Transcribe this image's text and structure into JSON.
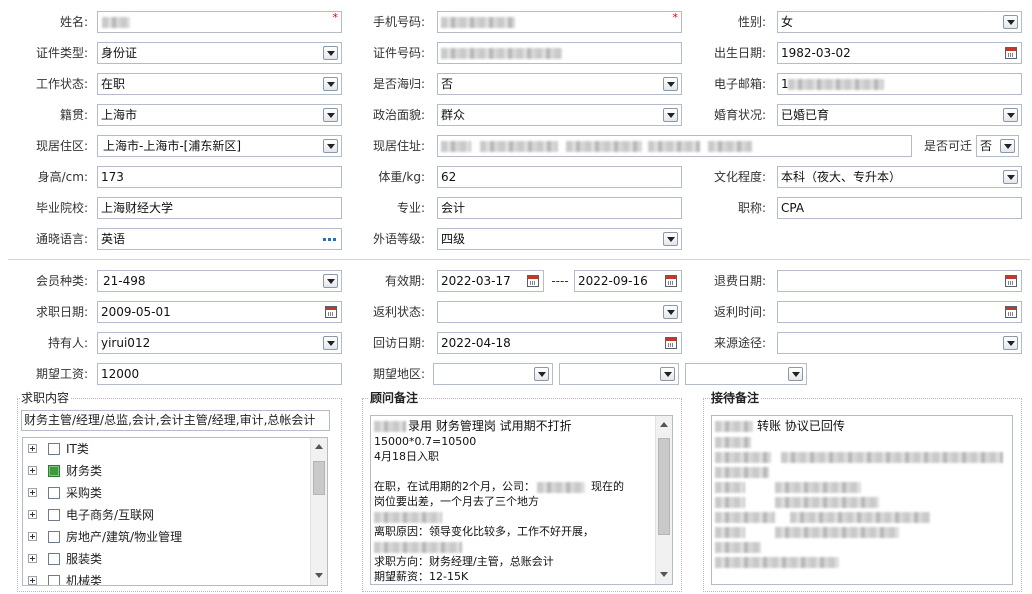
{
  "icons": {
    "dropdown": "chevron-down-icon",
    "calendar": "calendar-icon",
    "more": "ellipsis-icon",
    "expand": "plus-box-icon",
    "scroll_up": "arrow-up-icon",
    "scroll_down": "arrow-down-icon"
  },
  "colors": {
    "required_mark": "#e00000",
    "checked": "#3d9b3d",
    "field_border": "#b3bcc7"
  },
  "basic_info": {
    "name": {
      "label": "姓名:",
      "required_mark": "*"
    },
    "mobile": {
      "label": "手机号码:",
      "required_mark": "*"
    },
    "gender": {
      "label": "性别:",
      "value": "女"
    },
    "id_type": {
      "label": "证件类型:",
      "value": "身份证"
    },
    "id_number": {
      "label": "证件号码:"
    },
    "birth_date": {
      "label": "出生日期:",
      "value": "1982-03-02"
    },
    "work_status": {
      "label": "工作状态:",
      "value": "在职"
    },
    "returnee": {
      "label": "是否海归:",
      "value": "否"
    },
    "email": {
      "label": "电子邮箱:",
      "value": "1"
    },
    "native_place": {
      "label": "籍贯:",
      "value": "上海市"
    },
    "political_status": {
      "label": "政治面貌:",
      "value": "群众"
    },
    "marital_status": {
      "label": "婚育状况:",
      "value": "已婚已育"
    },
    "residence_district": {
      "label": "现居住区:",
      "value": "上海市-上海市-[浦东新区]"
    },
    "residence_address": {
      "label": "现居住址:"
    },
    "relocatable": {
      "label": "是否可迁",
      "value": "否"
    },
    "height": {
      "label": "身高/cm:",
      "value": "173"
    },
    "weight": {
      "label": "体重/kg:",
      "value": "62"
    },
    "education": {
      "label": "文化程度:",
      "value": "本科（夜大、专升本）"
    },
    "school": {
      "label": "毕业院校:",
      "value": "上海财经大学"
    },
    "major": {
      "label": "专业:",
      "value": "会计"
    },
    "professional_title": {
      "label": "职称:",
      "value": "CPA"
    },
    "languages": {
      "label": "通晓语言:",
      "value": "英语"
    },
    "foreign_language_level": {
      "label": "外语等级:",
      "value": "四级"
    }
  },
  "membership": {
    "member_type": {
      "label": "会员种类:",
      "value": "21-498"
    },
    "validity": {
      "label": "有效期:",
      "start": "2022-03-17",
      "separator": "----",
      "end": "2022-09-16"
    },
    "refund_date": {
      "label": "退费日期:"
    },
    "job_search_date": {
      "label": "求职日期:",
      "value": "2009-05-01"
    },
    "rebate_status": {
      "label": "返利状态:"
    },
    "rebate_time": {
      "label": "返利时间:"
    },
    "holder": {
      "label": "持有人:",
      "value": "yirui012"
    },
    "follow_up_date": {
      "label": "回访日期:",
      "value": "2022-04-18"
    },
    "source": {
      "label": "来源途径:"
    },
    "expected_salary": {
      "label": "期望工资:",
      "value": "12000"
    },
    "expected_region": {
      "label": "期望地区:"
    }
  },
  "job_content": {
    "title": "求职内容",
    "summary": "财务主管/经理/总监,会计,会计主管/经理,审计,总帐会计",
    "categories": [
      {
        "label": "IT类",
        "checked": false
      },
      {
        "label": "财务类",
        "checked": true
      },
      {
        "label": "采购类",
        "checked": false
      },
      {
        "label": "电子商务/互联网",
        "checked": false
      },
      {
        "label": "房地产/建筑/物业管理",
        "checked": false
      },
      {
        "label": "服装类",
        "checked": false
      },
      {
        "label": "机械类",
        "checked": false
      }
    ]
  },
  "consultant_notes": {
    "title": "顾问备注",
    "lines": [
      [
        "录用 财务管理岗 试用期不打折"
      ],
      [
        "15000*0.7=10500"
      ],
      [
        "4月18日入职"
      ],
      [],
      [
        "在职，在试用期的2个月，公司：",
        "现在的"
      ],
      [
        "岗位要出差，一个月去了三个地方"
      ],
      [],
      [
        "离职原因：领导变化比较多，工作不好开展，"
      ],
      [],
      [
        "求职方向：财务经理/主管，总账会计"
      ],
      [
        "期望薪资：12-15K"
      ]
    ]
  },
  "reception_notes": {
    "title": "接待备注",
    "lines": [
      [
        "转账 协议已回传"
      ]
    ]
  }
}
